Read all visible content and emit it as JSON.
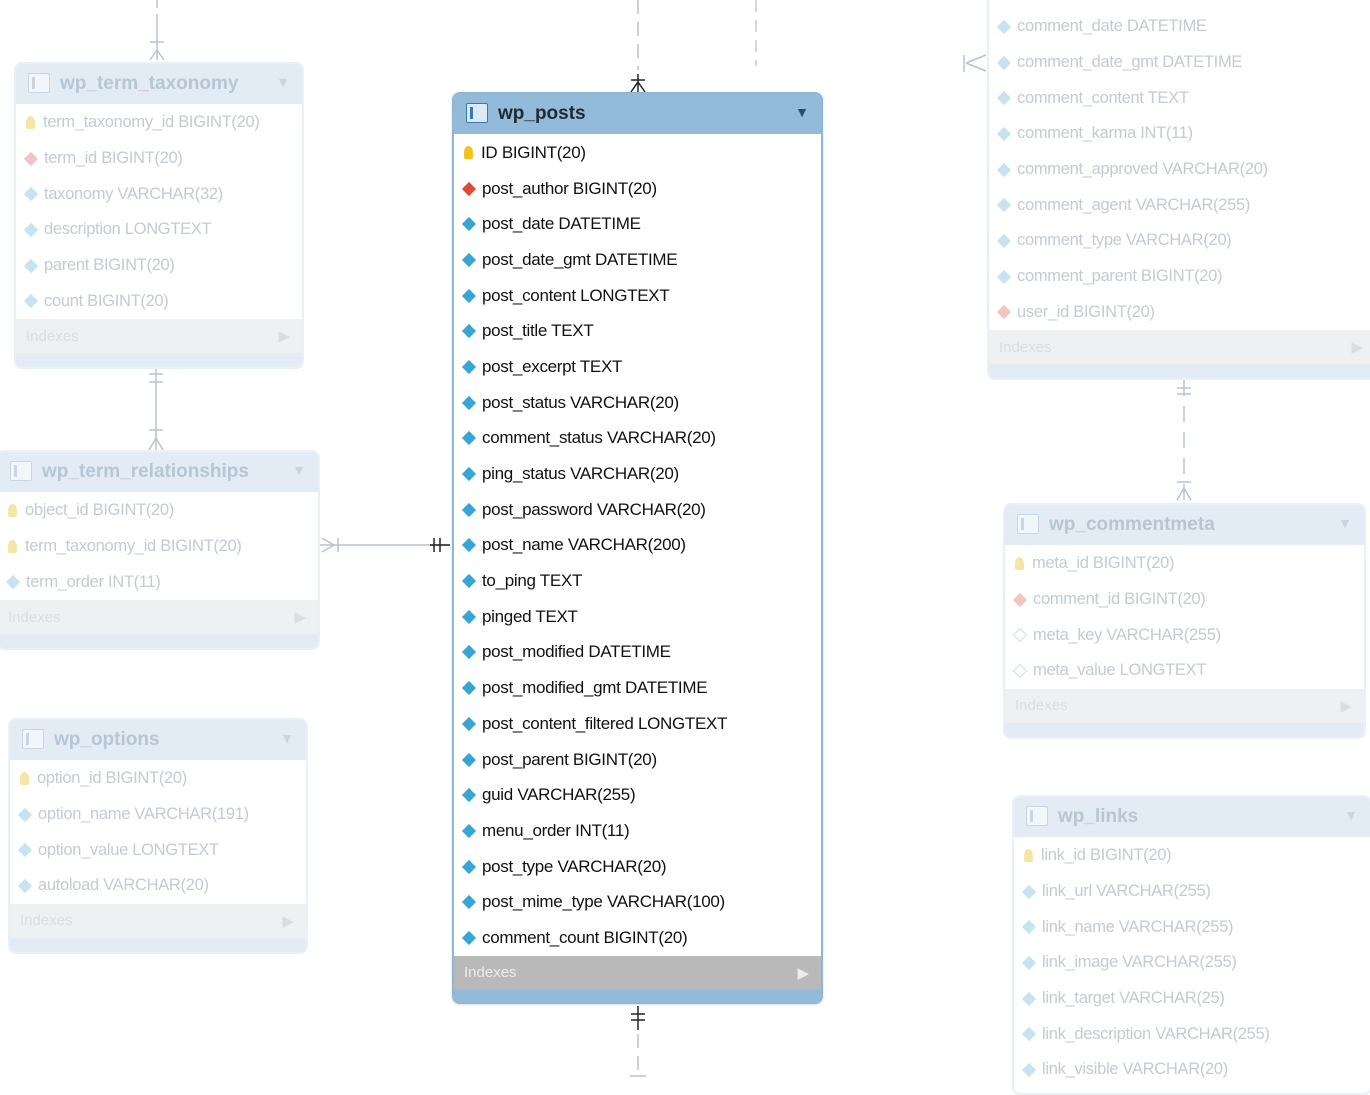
{
  "tables": {
    "wp_term_taxonomy": {
      "name": "wp_term_taxonomy",
      "columns": [
        {
          "text": "term_taxonomy_id BIGINT(20)",
          "key": "pk"
        },
        {
          "text": "term_id BIGINT(20)",
          "key": "fk"
        },
        {
          "text": "taxonomy VARCHAR(32)",
          "key": "nn"
        },
        {
          "text": "description LONGTEXT",
          "key": "nn"
        },
        {
          "text": "parent BIGINT(20)",
          "key": "nn"
        },
        {
          "text": "count BIGINT(20)",
          "key": "nn"
        }
      ],
      "indexes_label": "Indexes"
    },
    "wp_term_relationships": {
      "name": "wp_term_relationships",
      "columns": [
        {
          "text": "object_id BIGINT(20)",
          "key": "pk"
        },
        {
          "text": "term_taxonomy_id BIGINT(20)",
          "key": "pk"
        },
        {
          "text": "term_order INT(11)",
          "key": "nn"
        }
      ],
      "indexes_label": "Indexes"
    },
    "wp_options": {
      "name": "wp_options",
      "columns": [
        {
          "text": "option_id BIGINT(20)",
          "key": "pk"
        },
        {
          "text": "option_name VARCHAR(191)",
          "key": "nn"
        },
        {
          "text": "option_value LONGTEXT",
          "key": "nn"
        },
        {
          "text": "autoload VARCHAR(20)",
          "key": "nn"
        }
      ],
      "indexes_label": "Indexes"
    },
    "wp_posts": {
      "name": "wp_posts",
      "columns": [
        {
          "text": "ID BIGINT(20)",
          "key": "pk"
        },
        {
          "text": "post_author BIGINT(20)",
          "key": "fk"
        },
        {
          "text": "post_date DATETIME",
          "key": "nn"
        },
        {
          "text": "post_date_gmt DATETIME",
          "key": "nn"
        },
        {
          "text": "post_content LONGTEXT",
          "key": "nn"
        },
        {
          "text": "post_title TEXT",
          "key": "nn"
        },
        {
          "text": "post_excerpt TEXT",
          "key": "nn"
        },
        {
          "text": "post_status VARCHAR(20)",
          "key": "nn"
        },
        {
          "text": "comment_status VARCHAR(20)",
          "key": "nn"
        },
        {
          "text": "ping_status VARCHAR(20)",
          "key": "nn"
        },
        {
          "text": "post_password VARCHAR(20)",
          "key": "nn"
        },
        {
          "text": "post_name VARCHAR(200)",
          "key": "nn"
        },
        {
          "text": "to_ping TEXT",
          "key": "nn"
        },
        {
          "text": "pinged TEXT",
          "key": "nn"
        },
        {
          "text": "post_modified DATETIME",
          "key": "nn"
        },
        {
          "text": "post_modified_gmt DATETIME",
          "key": "nn"
        },
        {
          "text": "post_content_filtered LONGTEXT",
          "key": "nn"
        },
        {
          "text": "post_parent BIGINT(20)",
          "key": "nn"
        },
        {
          "text": "guid VARCHAR(255)",
          "key": "nn"
        },
        {
          "text": "menu_order INT(11)",
          "key": "nn"
        },
        {
          "text": "post_type VARCHAR(20)",
          "key": "nn"
        },
        {
          "text": "post_mime_type VARCHAR(100)",
          "key": "nn"
        },
        {
          "text": "comment_count BIGINT(20)",
          "key": "nn"
        }
      ],
      "indexes_label": "Indexes"
    },
    "wp_comments": {
      "name": "",
      "columns": [
        {
          "text": "comment_date DATETIME",
          "key": "nn"
        },
        {
          "text": "comment_date_gmt DATETIME",
          "key": "nn"
        },
        {
          "text": "comment_content TEXT",
          "key": "nn"
        },
        {
          "text": "comment_karma INT(11)",
          "key": "nn"
        },
        {
          "text": "comment_approved VARCHAR(20)",
          "key": "nn"
        },
        {
          "text": "comment_agent VARCHAR(255)",
          "key": "nn"
        },
        {
          "text": "comment_type VARCHAR(20)",
          "key": "nn"
        },
        {
          "text": "comment_parent BIGINT(20)",
          "key": "nn"
        },
        {
          "text": "user_id BIGINT(20)",
          "key": "fk"
        }
      ],
      "indexes_label": "Indexes"
    },
    "wp_commentmeta": {
      "name": "wp_commentmeta",
      "columns": [
        {
          "text": "meta_id BIGINT(20)",
          "key": "pk"
        },
        {
          "text": "comment_id BIGINT(20)",
          "key": "fk"
        },
        {
          "text": "meta_key VARCHAR(255)",
          "key": "op"
        },
        {
          "text": "meta_value LONGTEXT",
          "key": "op"
        }
      ],
      "indexes_label": "Indexes"
    },
    "wp_links": {
      "name": "wp_links",
      "columns": [
        {
          "text": "link_id BIGINT(20)",
          "key": "pk"
        },
        {
          "text": "link_url VARCHAR(255)",
          "key": "nn"
        },
        {
          "text": "link_name VARCHAR(255)",
          "key": "nn"
        },
        {
          "text": "link_image VARCHAR(255)",
          "key": "nn"
        },
        {
          "text": "link_target VARCHAR(25)",
          "key": "nn"
        },
        {
          "text": "link_description VARCHAR(255)",
          "key": "nn"
        },
        {
          "text": "link_visible VARCHAR(20)",
          "key": "nn"
        }
      ],
      "indexes_label": ""
    }
  },
  "colors": {
    "focused_header": "#93bad9",
    "faded_header": "#e3ecf4",
    "primary_key": "#f2c318",
    "foreign_key": "#e0483a",
    "not_null": "#37a6d4"
  }
}
